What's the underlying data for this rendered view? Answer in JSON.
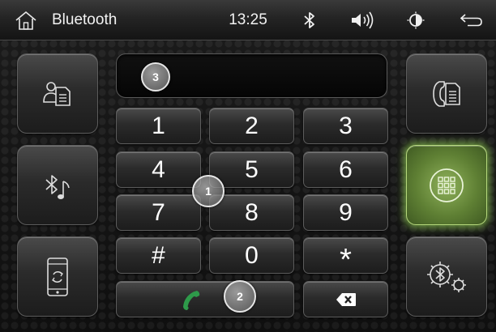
{
  "status_bar": {
    "home_icon": "home-icon",
    "title": "Bluetooth",
    "time": "13:25",
    "bluetooth_icon": "bluetooth-icon",
    "volume_icon": "volume-icon",
    "brightness_icon": "brightness-icon",
    "back_icon": "back-arrow-icon"
  },
  "number_display": {
    "value": "",
    "marker": "3"
  },
  "keypad": {
    "keys": [
      "1",
      "2",
      "3",
      "4",
      "5",
      "6",
      "7",
      "8",
      "9",
      "#",
      "0",
      "*"
    ],
    "call_marker": "2",
    "center_marker": "1"
  },
  "left_buttons": [
    "contacts-icon",
    "bluetooth-music-icon",
    "phone-sync-icon"
  ],
  "right_buttons": [
    "call-log-icon",
    "dialpad-grid-icon",
    "bluetooth-settings-icon"
  ],
  "colors": {
    "active_green": "#7fa84a",
    "call_green": "#2e9a4a"
  }
}
